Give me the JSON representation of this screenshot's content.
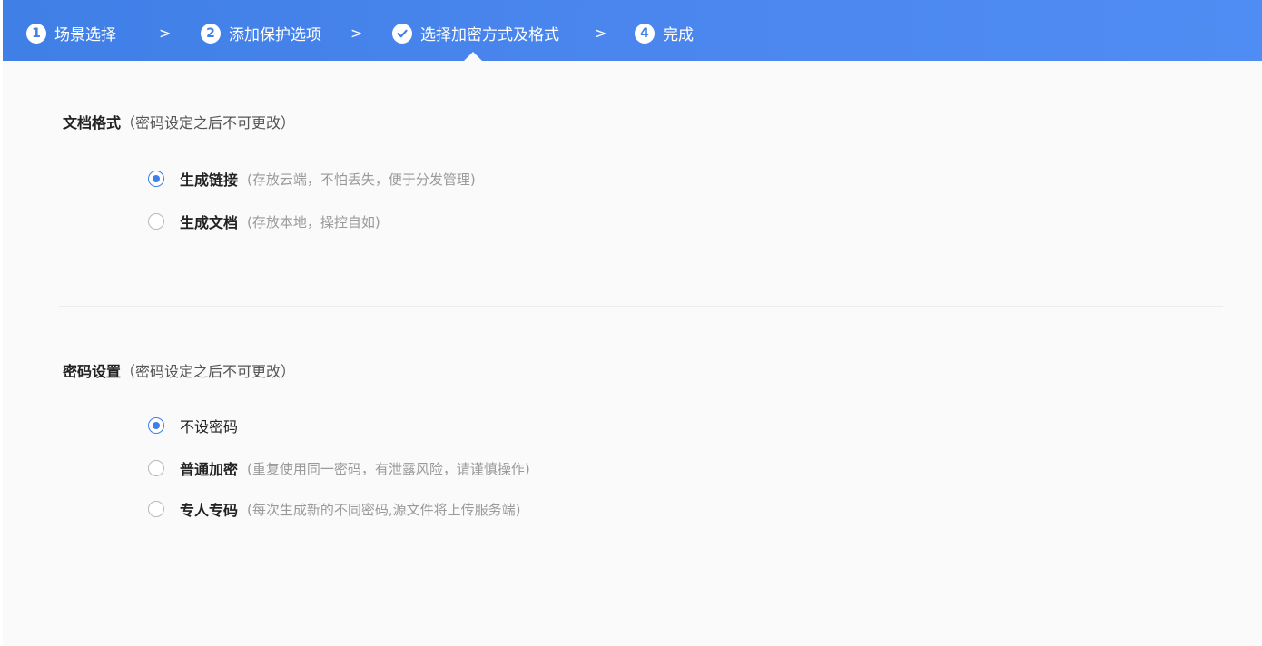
{
  "steps": [
    {
      "num": "1",
      "label": "场景选择"
    },
    {
      "num": "2",
      "label": "添加保护选项"
    },
    {
      "num": "",
      "label": "选择加密方式及格式"
    },
    {
      "num": "4",
      "label": "完成"
    }
  ],
  "separator": ">",
  "doc_format": {
    "title": "文档格式",
    "note": "（密码设定之后不可更改）",
    "options": [
      {
        "label": "生成链接",
        "desc": "(存放云端，不怕丢失，便于分发管理)",
        "selected": true
      },
      {
        "label": "生成文档",
        "desc": "(存放本地，操控自如)",
        "selected": false
      }
    ]
  },
  "password": {
    "title": "密码设置",
    "note": "（密码设定之后不可更改）",
    "options": [
      {
        "label": "不设密码",
        "desc": "",
        "selected": true
      },
      {
        "label": "普通加密",
        "desc": "(重复使用同一密码，有泄露风险，请谨慎操作)",
        "selected": false
      },
      {
        "label": "专人专码",
        "desc": "(每次生成新的不同密码,源文件将上传服务端)",
        "selected": false
      }
    ]
  },
  "colors": {
    "accent": "#3f7fe6",
    "header": "#4a86ee"
  }
}
